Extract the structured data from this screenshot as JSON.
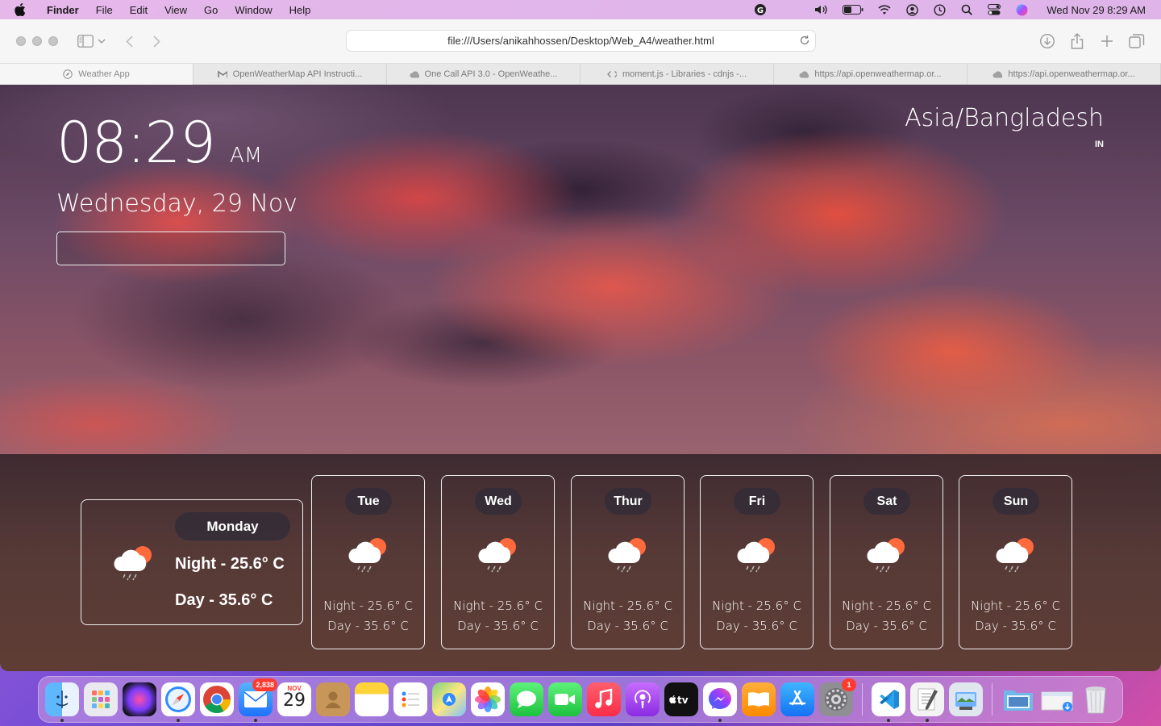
{
  "menubar": {
    "app_name": "Finder",
    "items": [
      "File",
      "Edit",
      "View",
      "Go",
      "Window",
      "Help"
    ],
    "clock": "Wed Nov 29  8:29 AM",
    "tray_icons": [
      "grammarly-icon",
      "volume-icon",
      "battery-icon",
      "wifi-icon",
      "user-icon",
      "time-machine-icon",
      "spotlight-icon",
      "control-center-icon",
      "siri-icon"
    ]
  },
  "browser": {
    "url": "file:///Users/anikahhossen/Desktop/Web_A4/weather.html",
    "tabs": [
      {
        "label": "Weather App",
        "icon": "compass-icon",
        "active": true
      },
      {
        "label": "OpenWeatherMap API Instructi...",
        "icon": "gmail-icon",
        "active": false
      },
      {
        "label": "One Call API 3.0 - OpenWeathe...",
        "icon": "cloud-icon",
        "active": false
      },
      {
        "label": "moment.js - Libraries - cdnjs -...",
        "icon": "code-icon",
        "active": false
      },
      {
        "label": "https://api.openweathermap.or...",
        "icon": "cloud-icon",
        "active": false
      },
      {
        "label": "https://api.openweathermap.or...",
        "icon": "cloud-icon",
        "active": false
      }
    ]
  },
  "weather": {
    "time": "08:29",
    "ampm": "AM",
    "date": "Wednesday, 29 Nov",
    "timezone": "Asia/Bangladesh",
    "country": "IN",
    "today": {
      "day": "Monday",
      "night": "Night - 25.6° C",
      "day_temp": "Day - 35.6° C"
    },
    "forecast": [
      {
        "day": "Tue",
        "night": "Night - 25.6° C",
        "day_temp": "Day - 35.6° C"
      },
      {
        "day": "Wed",
        "night": "Night - 25.6° C",
        "day_temp": "Day - 35.6° C"
      },
      {
        "day": "Thur",
        "night": "Night - 25.6° C",
        "day_temp": "Day - 35.6° C"
      },
      {
        "day": "Fri",
        "night": "Night - 25.6° C",
        "day_temp": "Day - 35.6° C"
      },
      {
        "day": "Sat",
        "night": "Night - 25.6° C",
        "day_temp": "Day - 35.6° C"
      },
      {
        "day": "Sun",
        "night": "Night - 25.6° C",
        "day_temp": "Day - 35.6° C"
      }
    ]
  },
  "dock": {
    "mail_badge": "2,838",
    "calendar_month": "NOV",
    "calendar_day": "29",
    "settings_badge": "1",
    "apps": [
      "finder",
      "launchpad",
      "siri",
      "safari",
      "chrome",
      "mail",
      "calendar",
      "contacts",
      "notes",
      "reminders",
      "maps",
      "photos",
      "messages",
      "facetime",
      "music",
      "podcasts",
      "apple-tv",
      "messenger",
      "books",
      "app-store",
      "system-preferences",
      "vscode",
      "textedit",
      "preview",
      "screenshots-folder",
      "downloads-folder",
      "trash"
    ]
  }
}
